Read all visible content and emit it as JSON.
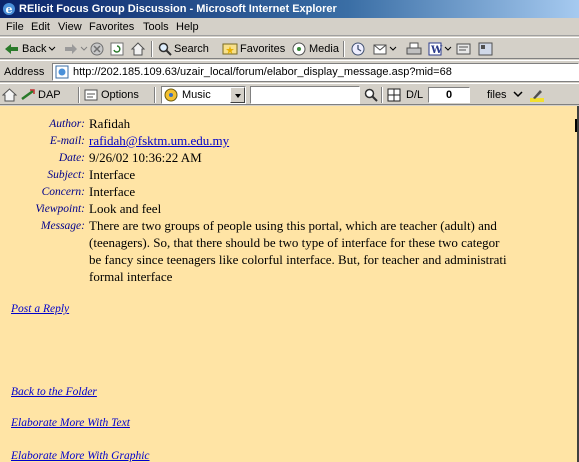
{
  "window": {
    "title": "RElicit Focus Group Discussion - Microsoft Internet Explorer"
  },
  "menu": [
    "File",
    "Edit",
    "View",
    "Favorites",
    "Tools",
    "Help"
  ],
  "toolbar": {
    "back": "Back",
    "search": "Search",
    "favorites": "Favorites",
    "media": "Media"
  },
  "address": {
    "label": "Address",
    "url": "http://202.185.109.63/uzair_local/forum/elabor_display_message.asp?mid=68"
  },
  "linksbar": {
    "dap": "DAP",
    "options": "Options",
    "music": "Music",
    "dl": "D/L",
    "count": "0",
    "files": "files"
  },
  "message": {
    "fields": [
      {
        "label": "Author:",
        "value": "Rafidah"
      },
      {
        "label": "E-mail:",
        "value": "rafidah@fsktm.um.edu.my"
      },
      {
        "label": "Date:",
        "value": "9/26/02 10:36:22 AM"
      },
      {
        "label": "Subject:",
        "value": "Interface"
      },
      {
        "label": "Concern:",
        "value": "Interface"
      },
      {
        "label": "Viewpoint:",
        "value": "Look and feel"
      }
    ],
    "body_label": "Message:",
    "body_lines": [
      "There are two groups of people using this portal, which are teacher (adult) and",
      "(teenagers). So, that there should be two type of interface for these two categor",
      "be fancy since teenagers like colorful interface. But, for teacher and administrati",
      "formal interface"
    ]
  },
  "links": {
    "post_reply": "Post a Reply",
    "back_to_folder": "Back to the Folder",
    "elaborate_text": "Elaborate More With Text",
    "elaborate_graphic": "Elaborate More With Graphic"
  }
}
